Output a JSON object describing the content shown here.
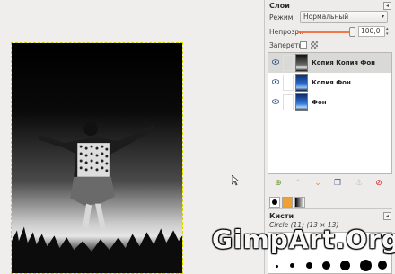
{
  "layers_panel": {
    "title": "Слои",
    "mode_label": "Режим:",
    "mode_value": "Нормальный",
    "opacity_label": "Непрозр.:",
    "opacity_value": "100,0",
    "opacity_percent": 100,
    "lock_label": "Запереть:",
    "layers": [
      {
        "name": "Копия Копия Фон",
        "visible": true,
        "active": true
      },
      {
        "name": "Копия Фон",
        "visible": true,
        "active": false
      },
      {
        "name": "Фон",
        "visible": true,
        "active": false
      }
    ],
    "buttons": [
      "new-layer-icon",
      "raise-layer-icon",
      "lower-layer-icon",
      "duplicate-layer-icon",
      "anchor-layer-icon",
      "delete-layer-icon"
    ]
  },
  "brushes_panel": {
    "title": "Кисти",
    "selected_brush": "Circle (11) (13 × 13)"
  },
  "watermark": "GimpArt.Org",
  "colors": {
    "accent_orange": "#f07746",
    "selection_border": "#d8d400",
    "active_row": "#d9d9d8"
  }
}
